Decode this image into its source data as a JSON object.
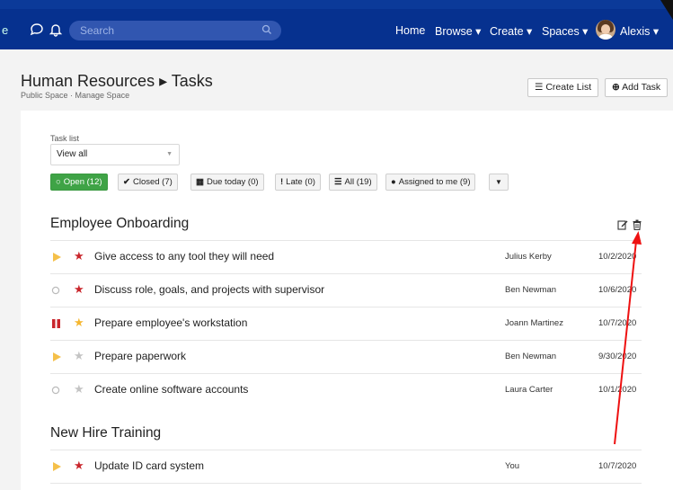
{
  "header": {
    "logo_fragment": "e",
    "search_placeholder": "Search",
    "nav": [
      "Home",
      "Browse ▾",
      "Create ▾",
      "Spaces ▾"
    ],
    "user_name": "Alexis ▾",
    "brand_color": "#0b3a99"
  },
  "page": {
    "title": "Human Resources ▸ Tasks",
    "subtitle": "Public Space · Manage Space",
    "create_list_label": "Create List",
    "add_task_label": "Add Task"
  },
  "filters": {
    "task_list_label": "Task list",
    "task_list_value": "View all",
    "pills": [
      {
        "icon": "circle-icon",
        "label": "Open (12)"
      },
      {
        "icon": "check-icon",
        "label": "Closed (7)"
      },
      {
        "icon": "calendar-icon",
        "label": "Due today (0)"
      },
      {
        "icon": "exclamation-icon",
        "label": "Late (0)"
      },
      {
        "icon": "list-icon",
        "label": "All (19)"
      },
      {
        "icon": "user-icon",
        "label": "Assigned to me (9)"
      }
    ],
    "active_color": "#3fa346"
  },
  "groups": [
    {
      "title": "Employee Onboarding",
      "tasks": [
        {
          "status": "in-progress",
          "starred": true,
          "name": "Give access to any tool they will need",
          "assignee": "Julius Kerby",
          "date": "10/2/2020"
        },
        {
          "status": "open",
          "starred": true,
          "name": "Discuss role, goals, and projects with supervisor",
          "assignee": "Ben Newman",
          "date": "10/6/2020"
        },
        {
          "status": "paused",
          "starred": false,
          "name": "Prepare employee's workstation",
          "assignee": "Joann Martinez",
          "date": "10/7/2020"
        },
        {
          "status": "in-progress",
          "starred": false,
          "name": "Prepare paperwork",
          "assignee": "Ben Newman",
          "date": "9/30/2020"
        },
        {
          "status": "open",
          "starred": false,
          "name": "Create online software accounts",
          "assignee": "Laura Carter",
          "date": "10/1/2020"
        }
      ]
    },
    {
      "title": "New Hire Training",
      "tasks": [
        {
          "status": "in-progress",
          "starred": true,
          "name": "Update ID card system",
          "assignee": "You",
          "date": "10/7/2020"
        }
      ]
    }
  ],
  "colors": {
    "star_red": "#c9262c",
    "star_yellow": "#f5b731",
    "star_gray": "#c4c4c4",
    "play_yellow": "#f5c04a",
    "pause_red": "#c9262c",
    "annotation_arrow": "#ee1111"
  }
}
